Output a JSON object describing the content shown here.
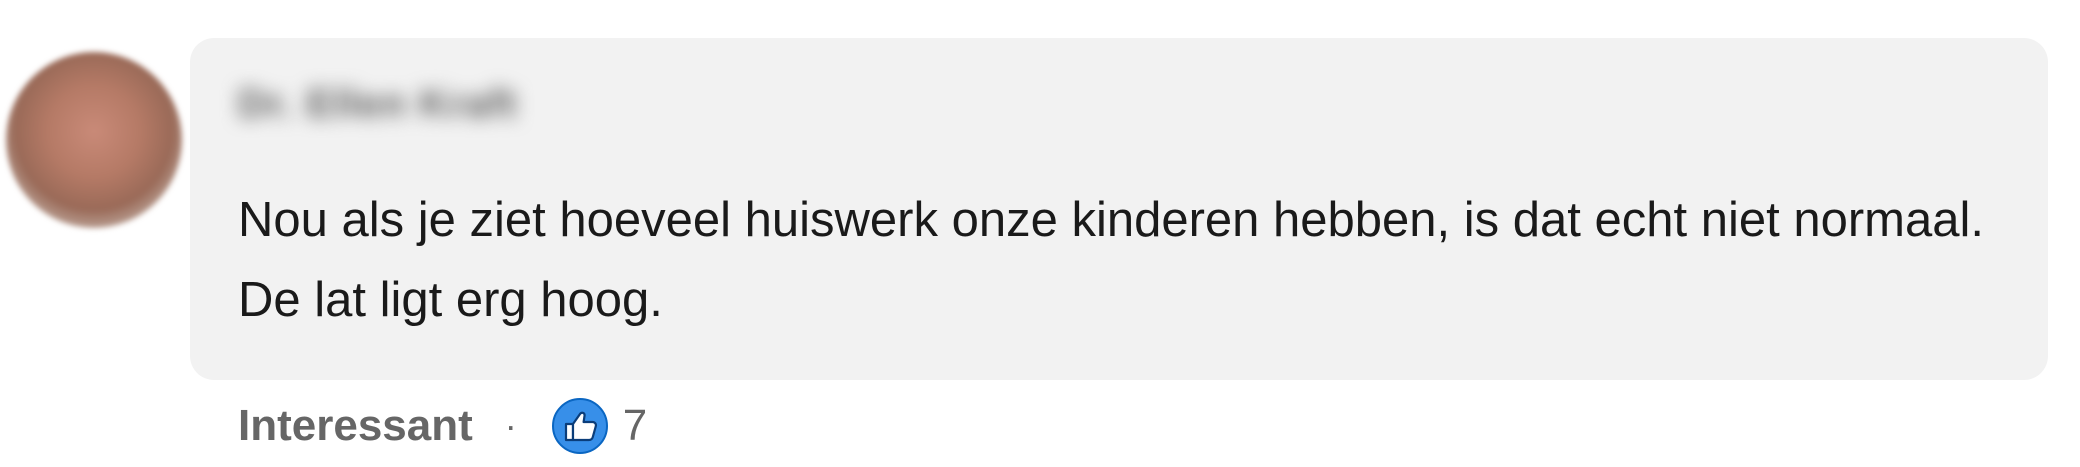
{
  "comment": {
    "author_name": "Dr. Ellen Kraft",
    "text": "Nou als je ziet hoeveel huiswerk onze kinderen hebben, is dat echt niet normaal. De lat ligt erg hoog."
  },
  "actions": {
    "react_label": "Interessant",
    "separator": "·",
    "reaction_icon": "thumbs-up-icon",
    "reaction_count": "7"
  },
  "colors": {
    "bubble_background": "#f2f2f2",
    "reaction_blue": "#378fe9",
    "muted_text": "#666666"
  }
}
